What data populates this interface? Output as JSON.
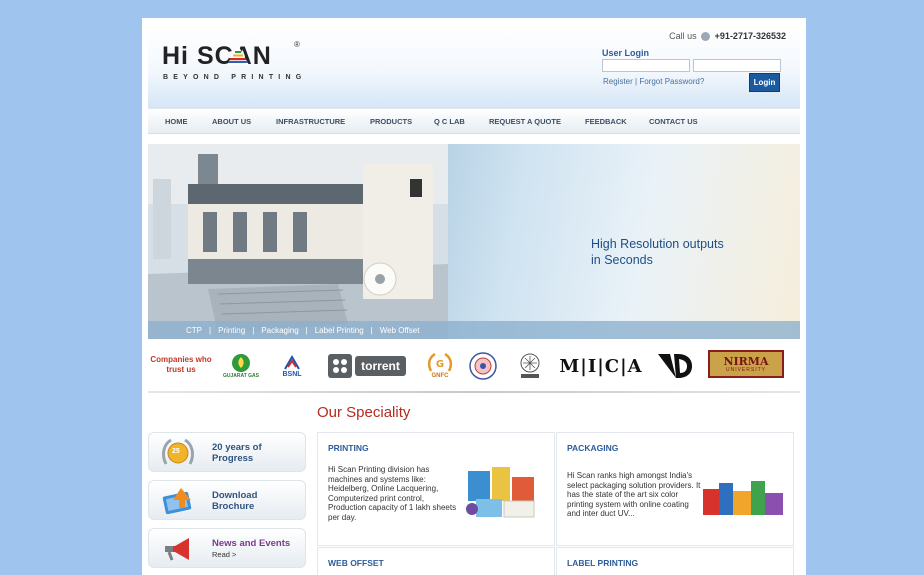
{
  "header": {
    "logo_text": "Hi SCAN",
    "logo_tagline": "BEYOND PRINTING",
    "logo_reg": "®",
    "call_label": "Call us",
    "call_number": "+91-2717-326532",
    "login_title": "User Login",
    "register_label": "Register",
    "forgot_label": "Forgot Password?",
    "login_button": "Login"
  },
  "nav": {
    "items": [
      "HOME",
      "ABOUT US",
      "INFRASTRUCTURE",
      "PRODUCTS",
      "Q C LAB",
      "REQUEST A QUOTE",
      "FEEDBACK",
      "CONTACT US"
    ]
  },
  "banner": {
    "headline": "High Resolution outputs\nin Seconds",
    "bar_items": [
      "CTP",
      "Printing",
      "Packaging",
      "Label Printing",
      "Web Offset"
    ]
  },
  "clients": {
    "label": "Companies who trust us",
    "logos": [
      {
        "name": "GUJARAT GAS",
        "text": "GUJARAT GAS"
      },
      {
        "name": "BSNL",
        "text": "BSNL"
      },
      {
        "name": "torrent",
        "text": "torrent"
      },
      {
        "name": "GNFC",
        "text": "GNFC"
      },
      {
        "name": "seal",
        "text": ""
      },
      {
        "name": "emblem",
        "text": ""
      },
      {
        "name": "MICA",
        "text": "M|I|C|A"
      },
      {
        "name": "ID",
        "text": ""
      },
      {
        "name": "NIRMA",
        "text": "NIRMA",
        "sub": "UNIVERSITY"
      }
    ]
  },
  "speciality": {
    "title": "Our Speciality",
    "side": [
      {
        "title": "20 years of\nProgress",
        "badge": "25"
      },
      {
        "title": "Download\nBrochure"
      },
      {
        "title": "News and Events",
        "sub": "Read >"
      }
    ],
    "cards": [
      {
        "title": "PRINTING",
        "body": "Hi Scan Printing division has machines and systems like: Heidelberg, Online Lacquering, Computerized print control, Production capacity of 1 lakh sheets per day."
      },
      {
        "title": "PACKAGING",
        "body": "Hi Scan ranks high amongst India's select packaging solution providers. It has the state of the art six color printing system with online coating and inter duct UV..."
      },
      {
        "title": "WEB OFFSET",
        "body": ""
      },
      {
        "title": "LABEL PRINTING",
        "body": ""
      }
    ]
  },
  "colors": {
    "background": "#9fc4ee",
    "nav_text": "#3b4f64",
    "accent_red": "#b52b1f",
    "link_blue": "#2d5c9a",
    "login_button": "#1c5aa0"
  }
}
